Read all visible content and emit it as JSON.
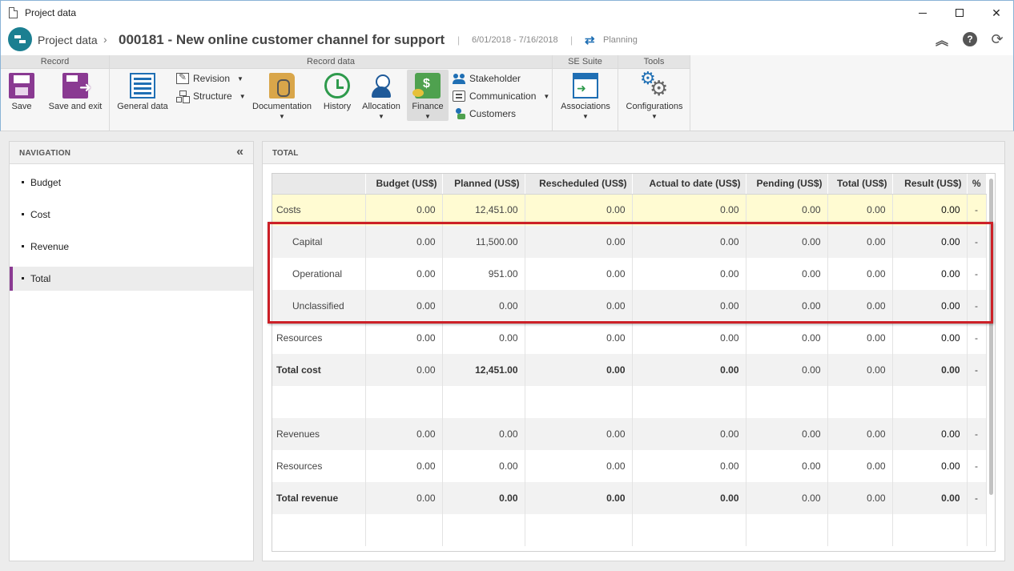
{
  "window": {
    "title": "Project data"
  },
  "header": {
    "app": "Project data",
    "separator": "›",
    "record": "000181 - New online customer channel for support",
    "dates": "6/01/2018 - 7/16/2018",
    "status": "Planning"
  },
  "ribbon": {
    "groups": {
      "record": "Record",
      "record_data": "Record data",
      "se_suite": "SE Suite",
      "tools": "Tools"
    },
    "buttons": {
      "save": "Save",
      "save_exit": "Save and exit",
      "general": "General data",
      "revision": "Revision",
      "structure": "Structure",
      "documentation": "Documentation",
      "history": "History",
      "allocation": "Allocation",
      "finance": "Finance",
      "stakeholder": "Stakeholder",
      "communication": "Communication",
      "customers": "Customers",
      "associations": "Associations",
      "configurations": "Configurations"
    },
    "active": "Finance"
  },
  "navigation": {
    "title": "NAVIGATION",
    "items": [
      "Budget",
      "Cost",
      "Revenue",
      "Total"
    ],
    "selected": "Total"
  },
  "main": {
    "title": "TOTAL",
    "columns": [
      "",
      "Budget (US$)",
      "Planned (US$)",
      "Rescheduled (US$)",
      "Actual to date (US$)",
      "Pending (US$)",
      "Total (US$)",
      "Result (US$)",
      "%"
    ],
    "rows": [
      {
        "label": "Costs",
        "values": [
          "0.00",
          "12,451.00",
          "0.00",
          "0.00",
          "0.00",
          "0.00",
          "0.00",
          "-"
        ]
      },
      {
        "label": "Capital",
        "values": [
          "0.00",
          "11,500.00",
          "0.00",
          "0.00",
          "0.00",
          "0.00",
          "0.00",
          "-"
        ]
      },
      {
        "label": "Operational",
        "values": [
          "0.00",
          "951.00",
          "0.00",
          "0.00",
          "0.00",
          "0.00",
          "0.00",
          "-"
        ]
      },
      {
        "label": "Unclassified",
        "values": [
          "0.00",
          "0.00",
          "0.00",
          "0.00",
          "0.00",
          "0.00",
          "0.00",
          "-"
        ]
      },
      {
        "label": "Resources",
        "values": [
          "0.00",
          "0.00",
          "0.00",
          "0.00",
          "0.00",
          "0.00",
          "0.00",
          "-"
        ]
      },
      {
        "label": "Total cost",
        "values": [
          "0.00",
          "12,451.00",
          "0.00",
          "0.00",
          "0.00",
          "0.00",
          "0.00",
          "-"
        ]
      },
      {
        "label": "Revenues",
        "values": [
          "0.00",
          "0.00",
          "0.00",
          "0.00",
          "0.00",
          "0.00",
          "0.00",
          "-"
        ]
      },
      {
        "label": "Resources",
        "values": [
          "0.00",
          "0.00",
          "0.00",
          "0.00",
          "0.00",
          "0.00",
          "0.00",
          "-"
        ]
      },
      {
        "label": "Total revenue",
        "values": [
          "0.00",
          "0.00",
          "0.00",
          "0.00",
          "0.00",
          "0.00",
          "0.00",
          "-"
        ]
      }
    ]
  },
  "colors": {
    "accent": "#8a3a92",
    "highlight": "#cc2027",
    "costs_row": "#fffbd2"
  }
}
